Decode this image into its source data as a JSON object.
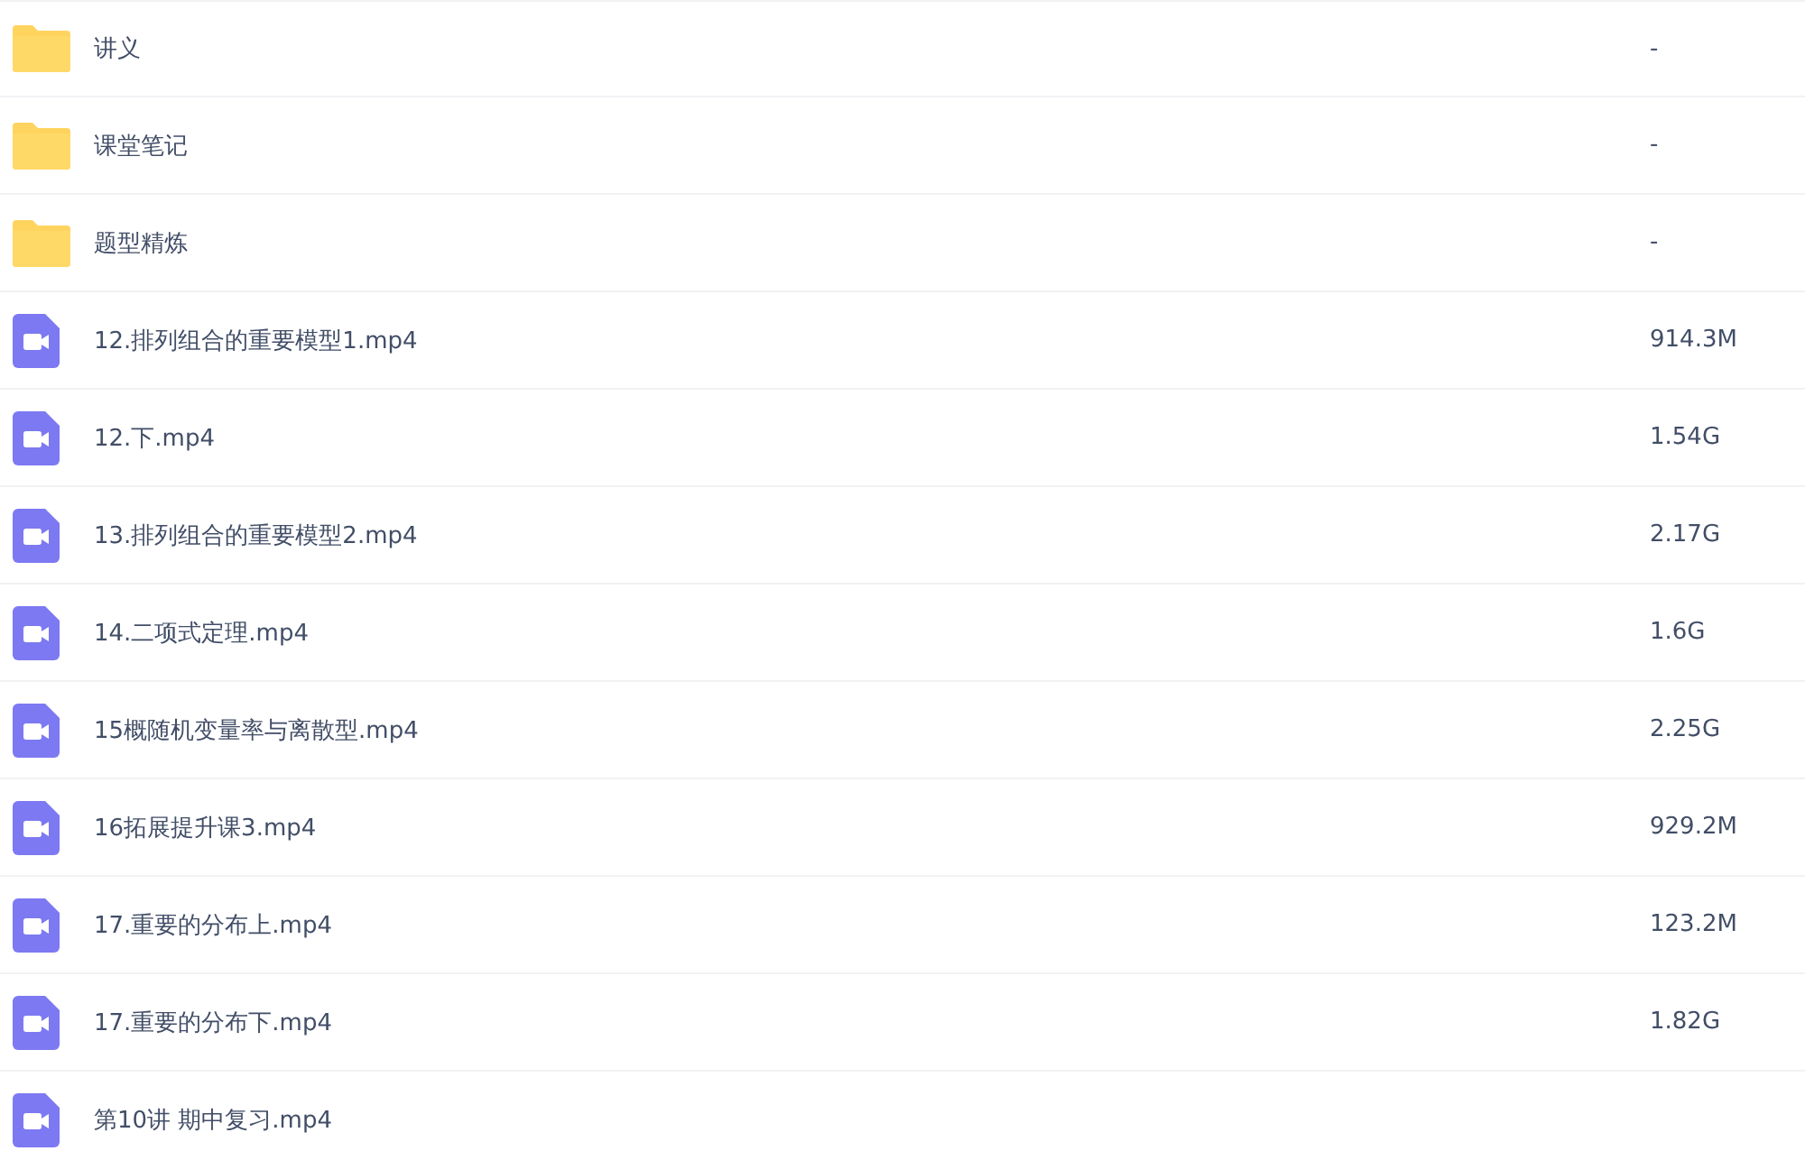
{
  "files": [
    {
      "kind": "folder",
      "name": "讲义",
      "size": "-"
    },
    {
      "kind": "folder",
      "name": "课堂笔记",
      "size": "-"
    },
    {
      "kind": "folder",
      "name": "题型精炼",
      "size": "-"
    },
    {
      "kind": "video",
      "name": "12.排列组合的重要模型1.mp4",
      "size": "914.3M"
    },
    {
      "kind": "video",
      "name": "12.下.mp4",
      "size": "1.54G"
    },
    {
      "kind": "video",
      "name": "13.排列组合的重要模型2.mp4",
      "size": "2.17G"
    },
    {
      "kind": "video",
      "name": "14.二项式定理.mp4",
      "size": "1.6G"
    },
    {
      "kind": "video",
      "name": "15概随机变量率与离散型.mp4",
      "size": "2.25G"
    },
    {
      "kind": "video",
      "name": "16拓展提升课3.mp4",
      "size": "929.2M"
    },
    {
      "kind": "video",
      "name": "17.重要的分布上.mp4",
      "size": "123.2M"
    },
    {
      "kind": "video",
      "name": "17.重要的分布下.mp4",
      "size": "1.82G"
    },
    {
      "kind": "video",
      "name": "第10讲 期中复习.mp4"
    }
  ]
}
